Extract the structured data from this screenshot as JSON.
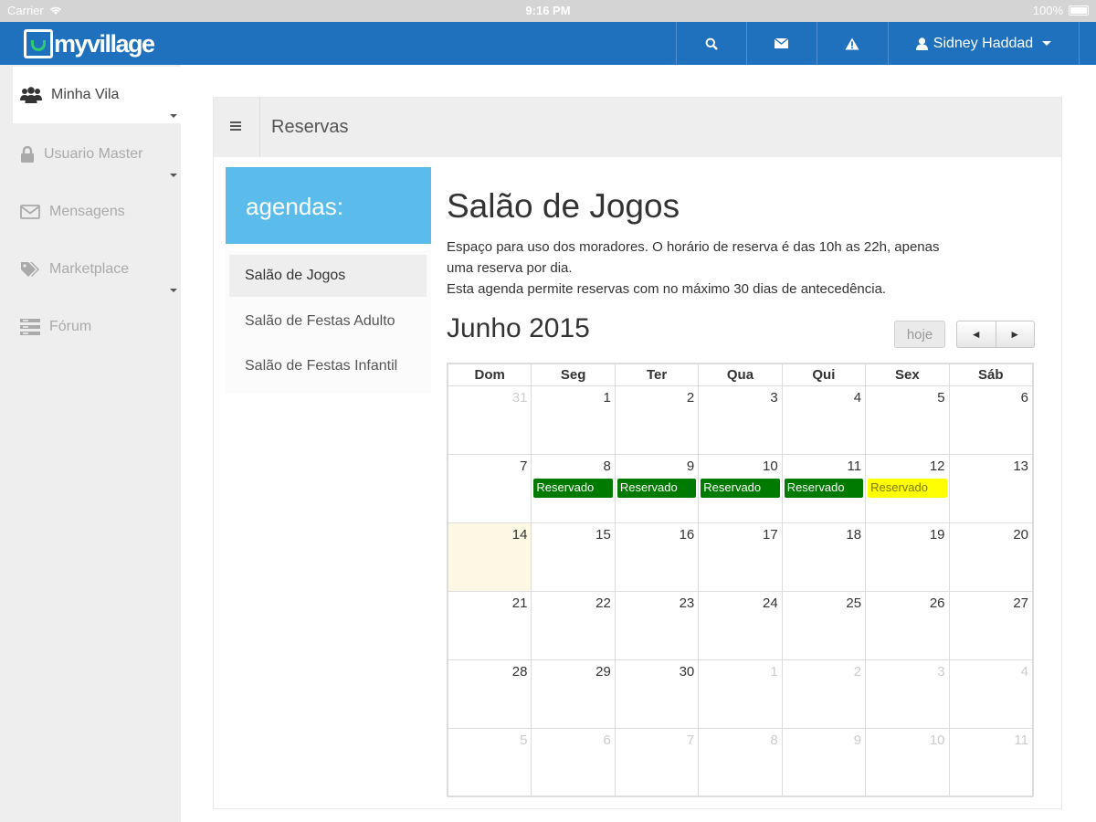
{
  "status_bar": {
    "carrier": "Carrier",
    "time": "9:16 PM",
    "battery": "100%"
  },
  "navbar": {
    "brand": "myvillage",
    "user_name": "Sidney Haddad",
    "icons": [
      "search-icon",
      "envelope-icon",
      "warning-icon",
      "user-icon"
    ]
  },
  "sidebar": {
    "items": [
      {
        "label": "Minha Vila",
        "icon": "users-icon",
        "active": true
      },
      {
        "label": "Usuario Master",
        "icon": "lock-icon"
      },
      {
        "label": "Mensagens",
        "icon": "envelope-icon"
      },
      {
        "label": "Marketplace",
        "icon": "tags-icon"
      },
      {
        "label": "Fórum",
        "icon": "forum-icon"
      }
    ]
  },
  "panel": {
    "title": "Reservas"
  },
  "agendas": {
    "heading": "agendas:",
    "items": [
      "Salão de Jogos",
      "Salão de Festas Adulto",
      "Salão de Festas Infantil"
    ]
  },
  "room": {
    "title": "Salão de Jogos",
    "desc_line1": "Espaço para uso dos moradores. O horário de reserva é das 10h as 22h, apenas",
    "desc_line2": "uma reserva por dia.",
    "desc_line3": "Esta agenda permite reservas com no máximo 30 dias de antecedência."
  },
  "calendar": {
    "month_title": "Junho 2015",
    "today_label": "hoje",
    "prev_label": "◄",
    "next_label": "►",
    "weekdays": [
      "Dom",
      "Seg",
      "Ter",
      "Qua",
      "Qui",
      "Sex",
      "Sáb"
    ],
    "weeks": [
      [
        {
          "d": "31",
          "o": true
        },
        {
          "d": "1"
        },
        {
          "d": "2"
        },
        {
          "d": "3"
        },
        {
          "d": "4"
        },
        {
          "d": "5"
        },
        {
          "d": "6"
        }
      ],
      [
        {
          "d": "7"
        },
        {
          "d": "8",
          "ev": "Reservado",
          "c": "green"
        },
        {
          "d": "9",
          "ev": "Reservado",
          "c": "green"
        },
        {
          "d": "10",
          "ev": "Reservado",
          "c": "green"
        },
        {
          "d": "11",
          "ev": "Reservado",
          "c": "green"
        },
        {
          "d": "12",
          "ev": "Reservado",
          "c": "yellow"
        },
        {
          "d": "13"
        }
      ],
      [
        {
          "d": "14",
          "today": true
        },
        {
          "d": "15"
        },
        {
          "d": "16"
        },
        {
          "d": "17"
        },
        {
          "d": "18"
        },
        {
          "d": "19"
        },
        {
          "d": "20"
        }
      ],
      [
        {
          "d": "21"
        },
        {
          "d": "22"
        },
        {
          "d": "23"
        },
        {
          "d": "24"
        },
        {
          "d": "25"
        },
        {
          "d": "26"
        },
        {
          "d": "27"
        }
      ],
      [
        {
          "d": "28"
        },
        {
          "d": "29"
        },
        {
          "d": "30"
        },
        {
          "d": "1",
          "o": true
        },
        {
          "d": "2",
          "o": true
        },
        {
          "d": "3",
          "o": true
        },
        {
          "d": "4",
          "o": true
        }
      ],
      [
        {
          "d": "5",
          "o": true
        },
        {
          "d": "6",
          "o": true
        },
        {
          "d": "7",
          "o": true
        },
        {
          "d": "8",
          "o": true
        },
        {
          "d": "9",
          "o": true
        },
        {
          "d": "10",
          "o": true
        },
        {
          "d": "11",
          "o": true
        }
      ]
    ]
  },
  "colors": {
    "navbar": "#1f70bd",
    "agendas_header": "#5bbcec",
    "reserved_green": "#007a00",
    "reserved_yellow": "#ffff00",
    "today_bg": "#fcf8e3"
  }
}
